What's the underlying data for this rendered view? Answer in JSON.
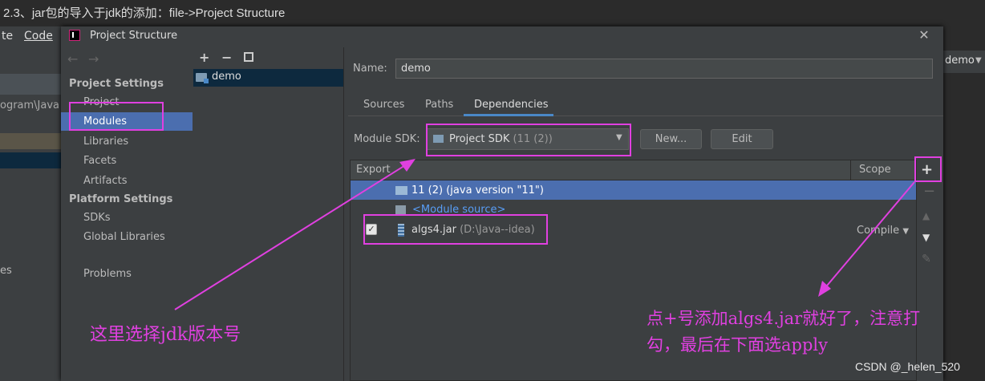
{
  "caption": "2.3、jar包的导入于jdk的添加：file->Project Structure",
  "background_ide": {
    "menu_items": [
      "te",
      "Code"
    ],
    "path_fragment": "ogram\\Java",
    "fragment_es": "es",
    "right_project": "demo"
  },
  "dialog": {
    "title": "Project Structure",
    "close_icon": "close-icon"
  },
  "sidebar": {
    "back_icon": "arrow-left-icon",
    "forward_icon": "arrow-right-icon",
    "project_settings_header": "Project Settings",
    "project_settings": [
      "Project",
      "Modules",
      "Libraries",
      "Facets",
      "Artifacts"
    ],
    "platform_settings_header": "Platform Settings",
    "platform_settings": [
      "SDKs",
      "Global Libraries"
    ],
    "problems": "Problems",
    "selected": "Modules"
  },
  "module_list": {
    "add": "+",
    "remove": "−",
    "copy_icon": "copy-icon",
    "modules": [
      "demo"
    ]
  },
  "main": {
    "name_label": "Name:",
    "name_value": "demo",
    "tabs": [
      "Sources",
      "Paths",
      "Dependencies"
    ],
    "active_tab": "Dependencies",
    "module_sdk_label": "Module SDK:",
    "module_sdk_value": "Project SDK",
    "module_sdk_version": "(11 (2))",
    "new_button": "New...",
    "edit_button": "Edit",
    "table": {
      "columns": [
        "Export",
        "Scope"
      ],
      "rows": [
        {
          "text": "11 (2) (java version \"11\")"
        },
        {
          "text": "<Module source>"
        },
        {
          "text": "algs4.jar",
          "path": "(D:\\Java--idea)",
          "checked": true,
          "scope": "Compile"
        }
      ]
    },
    "toolbar": {
      "add": "+",
      "remove": "−",
      "up": "▲",
      "down": "▼",
      "edit_icon": "pencil-icon"
    }
  },
  "annotations": {
    "left": "这里选择jdk版本号",
    "right_line1": "点+号添加algs4.jar就好了，注意打",
    "right_line2": "勾，最后在下面选apply",
    "color": "#e040e0"
  },
  "watermark": "CSDN @_helen_520"
}
